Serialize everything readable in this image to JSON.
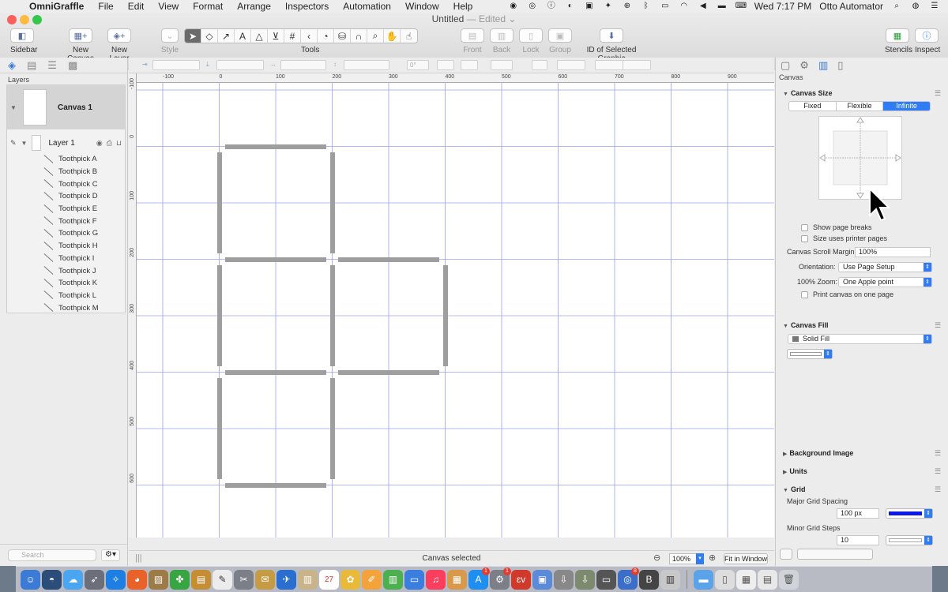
{
  "menubar": {
    "app": "OmniGraffle",
    "items": [
      "File",
      "Edit",
      "View",
      "Format",
      "Arrange",
      "Inspectors",
      "Automation",
      "Window",
      "Help"
    ],
    "clock": "Wed 7:17 PM",
    "user": "Otto Automator"
  },
  "window": {
    "title": "Untitled",
    "status": "— Edited ⌄"
  },
  "toolbar": {
    "sidebar": "Sidebar",
    "new_canvas": "New Canvas",
    "new_layer": "New Layer",
    "style": "Style",
    "tools": "Tools",
    "front": "Front",
    "back": "Back",
    "lock": "Lock",
    "group": "Group",
    "id_selected": "ID of Selected Graphic",
    "stencils": "Stencils",
    "inspect": "Inspect"
  },
  "format_bar": {
    "angle": "0°"
  },
  "layers_panel": {
    "label": "Layers",
    "canvas_name": "Canvas 1",
    "layer_name": "Layer 1",
    "items": [
      "Toothpick A",
      "Toothpick B",
      "Toothpick C",
      "Toothpick D",
      "Toothpick E",
      "Toothpick F",
      "Toothpick G",
      "Toothpick H",
      "Toothpick I",
      "Toothpick J",
      "Toothpick K",
      "Toothpick L",
      "Toothpick M"
    ],
    "search_placeholder": "Search"
  },
  "rulers": {
    "h_labels": [
      "-100",
      "0",
      "100",
      "200",
      "300",
      "400",
      "500",
      "600",
      "700",
      "800",
      "900"
    ],
    "v_labels": [
      "-100",
      "0",
      "100",
      "200",
      "300",
      "400",
      "500",
      "600"
    ]
  },
  "statusbar": {
    "text": "Canvas selected",
    "zoom": "100%",
    "fit": "Fit in Window"
  },
  "inspector": {
    "label": "Canvas",
    "canvas_size": {
      "title": "Canvas Size",
      "modes": [
        "Fixed",
        "Flexible",
        "Infinite"
      ],
      "selected": "Infinite"
    },
    "show_page_breaks": "Show page breaks",
    "printer_pages": "Size uses printer pages",
    "scroll_margin_label": "Canvas Scroll Margin:",
    "scroll_margin": "100%",
    "orientation_label": "Orientation:",
    "orientation": "Use Page Setup",
    "zoom_label": "100% Zoom:",
    "zoom": "One Apple point",
    "print_one_page": "Print canvas on one page",
    "canvas_fill": {
      "title": "Canvas Fill",
      "type": "Solid Fill"
    },
    "background_image": "Background Image",
    "units": "Units",
    "grid": {
      "title": "Grid",
      "major_label": "Major Grid Spacing",
      "major_value": "100 px",
      "major_color": "#0a18e8",
      "minor_label": "Minor Grid Steps",
      "minor_value": "10"
    }
  },
  "colors": {
    "accent": "#2f7cf6",
    "grid_line": "#9aa0f0",
    "toothpick": "#9e9e9e"
  },
  "dock": {
    "calendar_day": "27",
    "badges": [
      "1",
      "1",
      "8"
    ]
  }
}
